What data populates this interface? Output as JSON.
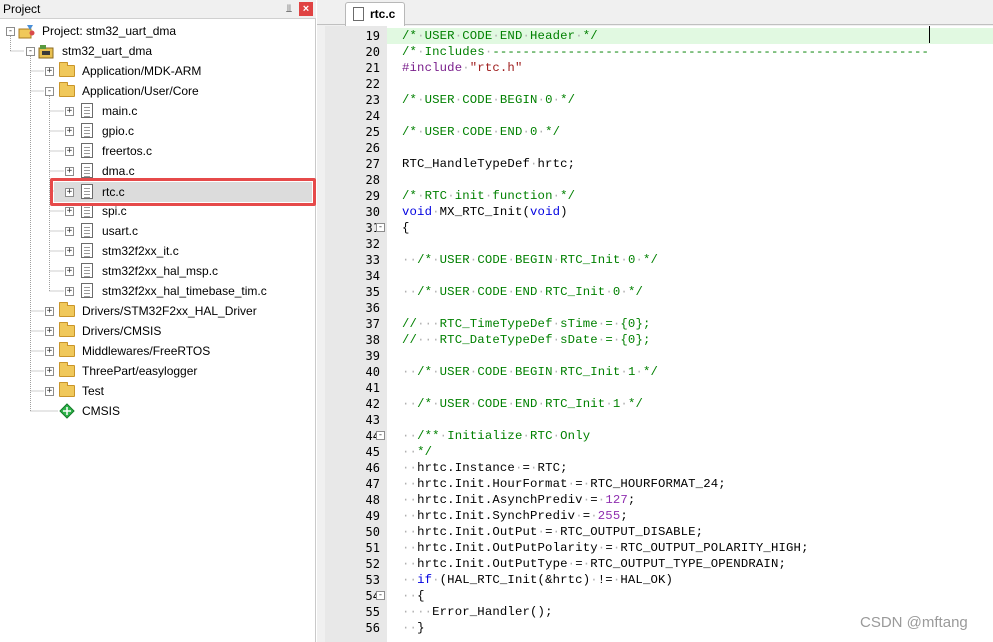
{
  "project_pane": {
    "title": "Project",
    "pin_icon": "pin-icon",
    "close_icon": "close-icon",
    "tree": [
      {
        "label": "Project: stm32_uart_dma",
        "icon": "project-icon",
        "expander": "-"
      },
      {
        "label": "stm32_uart_dma",
        "icon": "target-icon",
        "expander": "-"
      },
      {
        "label": "Application/MDK-ARM",
        "icon": "folder-icon",
        "expander": "+"
      },
      {
        "label": "Application/User/Core",
        "icon": "folder-icon",
        "expander": "-"
      },
      {
        "label": "main.c",
        "icon": "file-icon",
        "expander": "+"
      },
      {
        "label": "gpio.c",
        "icon": "file-icon",
        "expander": "+"
      },
      {
        "label": "freertos.c",
        "icon": "file-icon",
        "expander": "+"
      },
      {
        "label": "dma.c",
        "icon": "file-icon",
        "expander": "+"
      },
      {
        "label": "rtc.c",
        "icon": "file-icon",
        "expander": "+",
        "selected": true
      },
      {
        "label": "spi.c",
        "icon": "file-icon",
        "expander": "+"
      },
      {
        "label": "usart.c",
        "icon": "file-icon",
        "expander": "+"
      },
      {
        "label": "stm32f2xx_it.c",
        "icon": "file-icon",
        "expander": "+"
      },
      {
        "label": "stm32f2xx_hal_msp.c",
        "icon": "file-icon",
        "expander": "+"
      },
      {
        "label": "stm32f2xx_hal_timebase_tim.c",
        "icon": "file-icon",
        "expander": "+"
      },
      {
        "label": "Drivers/STM32F2xx_HAL_Driver",
        "icon": "folder-icon",
        "expander": "+"
      },
      {
        "label": "Drivers/CMSIS",
        "icon": "folder-icon",
        "expander": "+"
      },
      {
        "label": "Middlewares/FreeRTOS",
        "icon": "folder-icon",
        "expander": "+"
      },
      {
        "label": "ThreePart/easylogger",
        "icon": "folder-icon",
        "expander": "+"
      },
      {
        "label": "Test",
        "icon": "folder-icon",
        "expander": "+"
      },
      {
        "label": "CMSIS",
        "icon": "cmsis-diamond-icon",
        "expander": ""
      }
    ],
    "highlight_color": "#e64a4a"
  },
  "editor": {
    "tab_label": "rtc.c",
    "current_line_color": "#e1f9e1",
    "lines": [
      {
        "n": "19",
        "t": "/*·USER·CODE·END·Header·*/",
        "k": "comment"
      },
      {
        "n": "20",
        "t": "/*·Includes·----------------------------------------------------------",
        "k": "comment"
      },
      {
        "n": "21",
        "t": "#include·\"rtc.h\"",
        "k": "include"
      },
      {
        "n": "22",
        "t": "",
        "k": "plain"
      },
      {
        "n": "23",
        "t": "/*·USER·CODE·BEGIN·0·*/",
        "k": "comment"
      },
      {
        "n": "24",
        "t": "",
        "k": "plain"
      },
      {
        "n": "25",
        "t": "/*·USER·CODE·END·0·*/",
        "k": "comment"
      },
      {
        "n": "26",
        "t": "",
        "k": "plain"
      },
      {
        "n": "27",
        "t": "RTC_HandleTypeDef·hrtc;",
        "k": "plain"
      },
      {
        "n": "28",
        "t": "",
        "k": "plain"
      },
      {
        "n": "29",
        "t": "/*·RTC·init·function·*/",
        "k": "comment"
      },
      {
        "n": "30",
        "t": "void·MX_RTC_Init(void)",
        "k": "func"
      },
      {
        "n": "31",
        "t": "{",
        "k": "plain",
        "fold": "-"
      },
      {
        "n": "32",
        "t": "",
        "k": "plain"
      },
      {
        "n": "33",
        "t": "··/*·USER·CODE·BEGIN·RTC_Init·0·*/",
        "k": "comment"
      },
      {
        "n": "34",
        "t": "",
        "k": "plain"
      },
      {
        "n": "35",
        "t": "··/*·USER·CODE·END·RTC_Init·0·*/",
        "k": "comment"
      },
      {
        "n": "36",
        "t": "",
        "k": "plain"
      },
      {
        "n": "37",
        "t": "//···RTC_TimeTypeDef·sTime·=·{0};",
        "k": "comment"
      },
      {
        "n": "38",
        "t": "//···RTC_DateTypeDef·sDate·=·{0};",
        "k": "comment"
      },
      {
        "n": "39",
        "t": "",
        "k": "plain"
      },
      {
        "n": "40",
        "t": "··/*·USER·CODE·BEGIN·RTC_Init·1·*/",
        "k": "comment"
      },
      {
        "n": "41",
        "t": "",
        "k": "plain"
      },
      {
        "n": "42",
        "t": "··/*·USER·CODE·END·RTC_Init·1·*/",
        "k": "comment"
      },
      {
        "n": "43",
        "t": "",
        "k": "plain"
      },
      {
        "n": "44",
        "t": "··/**·Initialize·RTC·Only",
        "k": "comment",
        "fold": "-"
      },
      {
        "n": "45",
        "t": "··*/",
        "k": "comment"
      },
      {
        "n": "46",
        "t": "··hrtc.Instance·=·RTC;",
        "k": "plain"
      },
      {
        "n": "47",
        "t": "··hrtc.Init.HourFormat·=·RTC_HOURFORMAT_24;",
        "k": "plain"
      },
      {
        "n": "48",
        "t": "··hrtc.Init.AsynchPrediv·=·127;",
        "k": "num127"
      },
      {
        "n": "49",
        "t": "··hrtc.Init.SynchPrediv·=·255;",
        "k": "num255"
      },
      {
        "n": "50",
        "t": "··hrtc.Init.OutPut·=·RTC_OUTPUT_DISABLE;",
        "k": "plain"
      },
      {
        "n": "51",
        "t": "··hrtc.Init.OutPutPolarity·=·RTC_OUTPUT_POLARITY_HIGH;",
        "k": "plain"
      },
      {
        "n": "52",
        "t": "··hrtc.Init.OutPutType·=·RTC_OUTPUT_TYPE_OPENDRAIN;",
        "k": "plain"
      },
      {
        "n": "53",
        "t": "··if·(HAL_RTC_Init(&hrtc)·!=·HAL_OK)",
        "k": "if"
      },
      {
        "n": "54",
        "t": "··{",
        "k": "plain",
        "fold": "-"
      },
      {
        "n": "55",
        "t": "····Error_Handler();",
        "k": "plain"
      },
      {
        "n": "56",
        "t": "··}",
        "k": "plain"
      }
    ]
  },
  "watermark": "CSDN @mftang"
}
